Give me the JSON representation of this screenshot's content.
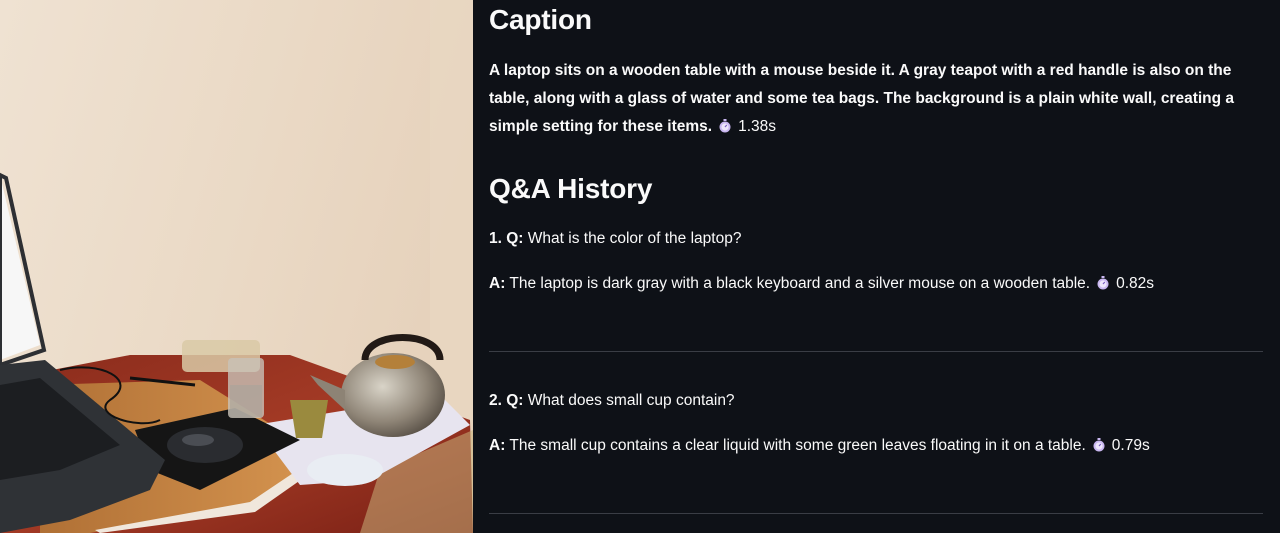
{
  "caption": {
    "heading": "Caption",
    "text": "A laptop sits on a wooden table with a mouse beside it. A gray teapot with a red handle is also on the table, along with a glass of water and some tea bags. The background is a plain white wall, creating a simple setting for these items.",
    "time": "1.38s"
  },
  "qa": {
    "heading": "Q&A History",
    "items": [
      {
        "index": "1.",
        "q_label": "Q:",
        "question": "What is the color of the laptop?",
        "a_label": "A:",
        "answer": "The laptop is dark gray with a black keyboard and a silver mouse on a wooden table.",
        "time": "0.82s"
      },
      {
        "index": "2.",
        "q_label": "Q:",
        "question": "What does small cup contain?",
        "a_label": "A:",
        "answer": "The small cup contains a clear liquid with some green leaves floating in it on a table.",
        "time": "0.79s"
      }
    ]
  },
  "icons": {
    "timer": "stopwatch-icon"
  },
  "colors": {
    "background": "#0e1117",
    "text": "#fafafa",
    "divider": "#3a3d45",
    "stopwatch": "#c9b7f0"
  }
}
